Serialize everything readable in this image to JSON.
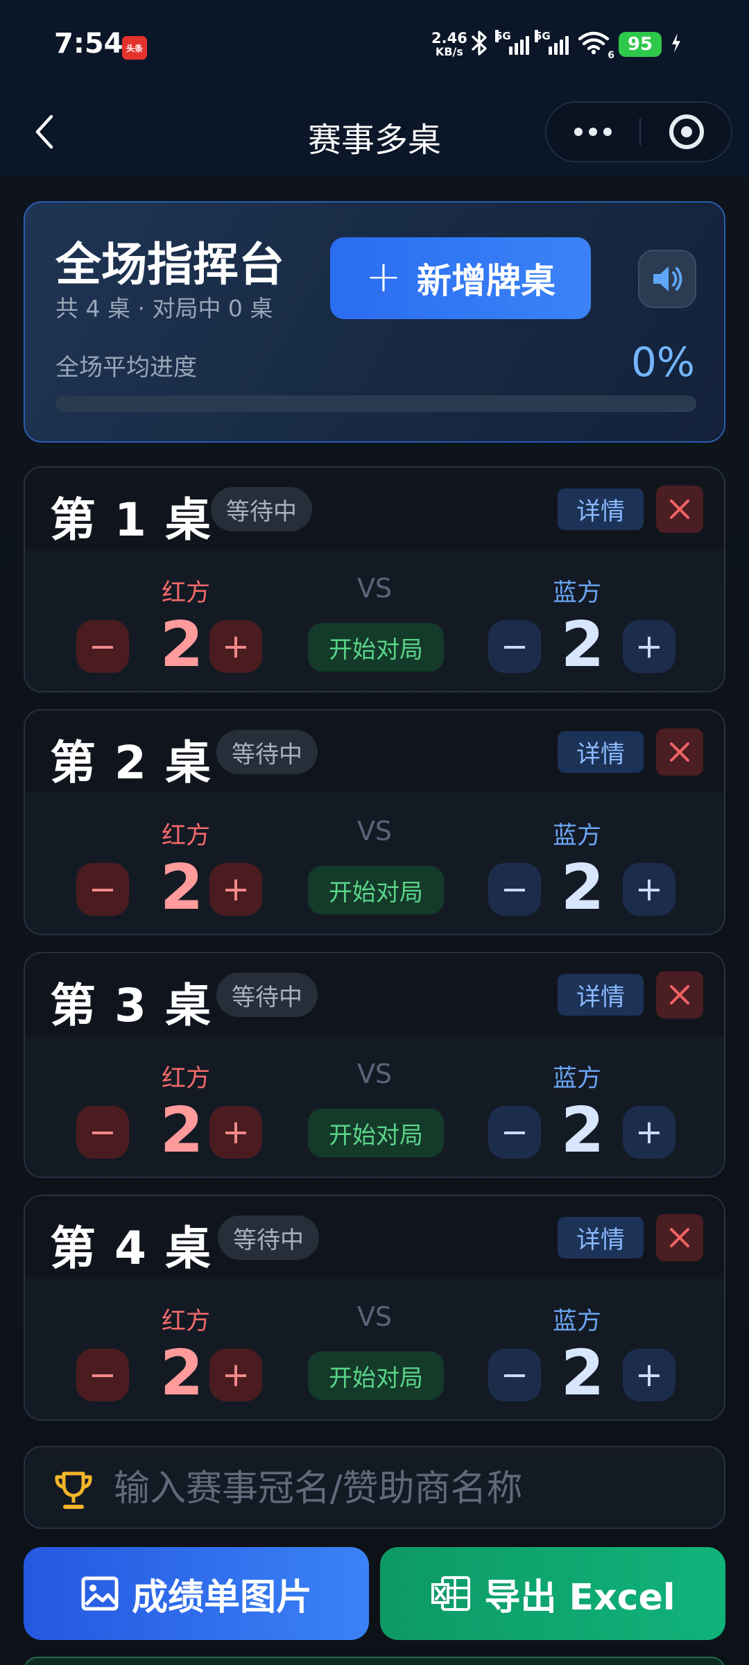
{
  "status_bar": {
    "time": "7:54",
    "app_badge": "头条",
    "speed_value": "2.46",
    "speed_unit": "KB/s",
    "network_1": "5G",
    "network_2": "5G",
    "wifi_level": "6",
    "battery": "95",
    "icons": [
      "bluetooth-icon",
      "signal-icon",
      "wifi-icon",
      "battery-icon",
      "charging-icon"
    ]
  },
  "header": {
    "title": "赛事多桌",
    "icons": [
      "back-icon",
      "more-icon",
      "close-miniprogram-icon"
    ]
  },
  "command_panel": {
    "title": "全场指挥台",
    "subtitle": "共 4 桌 · 对局中 0 桌",
    "add_button": "新增牌桌",
    "progress_label": "全场平均进度",
    "progress_text": "0%",
    "progress_value": 0
  },
  "tables": [
    {
      "name": "第 1 桌",
      "status": "等待中",
      "detail": "详情",
      "red_label": "红方",
      "vs": "VS",
      "blue_label": "蓝方",
      "red_score": "2",
      "blue_score": "2",
      "start": "开始对局",
      "minus": "−",
      "plus": "+"
    },
    {
      "name": "第 2 桌",
      "status": "等待中",
      "detail": "详情",
      "red_label": "红方",
      "vs": "VS",
      "blue_label": "蓝方",
      "red_score": "2",
      "blue_score": "2",
      "start": "开始对局",
      "minus": "−",
      "plus": "+"
    },
    {
      "name": "第 3 桌",
      "status": "等待中",
      "detail": "详情",
      "red_label": "红方",
      "vs": "VS",
      "blue_label": "蓝方",
      "red_score": "2",
      "blue_score": "2",
      "start": "开始对局",
      "minus": "−",
      "plus": "+"
    },
    {
      "name": "第 4 桌",
      "status": "等待中",
      "detail": "详情",
      "red_label": "红方",
      "vs": "VS",
      "blue_label": "蓝方",
      "red_score": "2",
      "blue_score": "2",
      "start": "开始对局",
      "minus": "−",
      "plus": "+"
    }
  ],
  "sponsor": {
    "placeholder": "输入赛事冠名/赞助商名称",
    "value": ""
  },
  "actions": {
    "image_button": "成绩单图片",
    "excel_button": "导出 Excel"
  },
  "colors": {
    "accent_blue": "#3b82f6",
    "red_side": "#f36b6b",
    "blue_side": "#6aa6f5",
    "green_start": "#5ad489",
    "excel_green": "#10b37a"
  }
}
